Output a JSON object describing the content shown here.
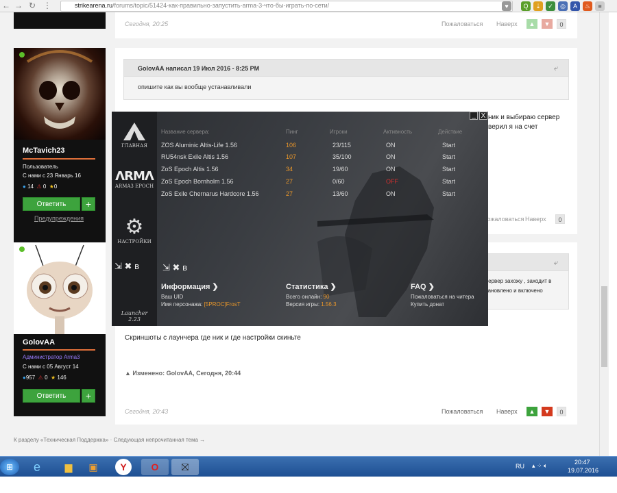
{
  "browser": {
    "url_host": "strikearena.ru",
    "url_path": "/forums/topic/51424-как-правильно-запустить-arma-3-что-бы-играть-по-сети/"
  },
  "top_post": {
    "date": "Сегодня, 20:25",
    "report": "Пожаловаться",
    "up": "Наверх",
    "count": "0"
  },
  "user1": {
    "name": "McTavich23",
    "role": "Пользователь",
    "joined": "С нами с 23 Январь 16",
    "posts": "14",
    "warns": "0",
    "rep": "0",
    "reply": "Ответить",
    "plus": "+",
    "warnings_link": "Предупреждения"
  },
  "post1": {
    "quote_head": "GolovAA написал 19 Июл 2016 - 8:25 PM",
    "quote_text": "опишите как вы вообще устанавливали",
    "text_line1": "ник и выбираю сервер",
    "text_line2": "верил я на счет",
    "report": "Пожаловаться",
    "up": "Наверх",
    "count": "0"
  },
  "user2": {
    "name": "GolovAA",
    "role": "Администратор Arma3",
    "joined": "С нами с 05 Август 14",
    "posts": "957",
    "warns": "0",
    "rep": "146",
    "reply": "Ответить",
    "plus": "+"
  },
  "post2": {
    "text_line1": "вервер захожу , заходит в",
    "text_line2": "тановлено  и включено",
    "main_text": "Скриншоты с лаунчера где ник и где настройки скиньте",
    "edited": "Изменено: GolovAA, Сегодня, 20:44",
    "date": "Сегодня, 20:43",
    "report": "Пожаловаться",
    "up": "Наверх",
    "count": "0"
  },
  "footer": {
    "links": "К разделу «Техническая Поддержка» · Следующая непрочитанная тема →"
  },
  "launcher": {
    "nav": [
      "ГЛАВНАЯ",
      "ARMA3 EPOCH",
      "НАСТРОЙКИ"
    ],
    "version_label": "Launcher",
    "version": "2.23",
    "headers": {
      "name": "Название сервера:",
      "ping": "Пинг",
      "players": "Игроки",
      "activity": "Активность",
      "action": "Действие"
    },
    "servers": [
      {
        "name": "ZOS Aluminic Altis-Life 1.56",
        "ping": "106",
        "players": "23/115",
        "status": "ON",
        "action": "Start"
      },
      {
        "name": "RU54nsk Exile Altis 1.56",
        "ping": "107",
        "players": "35/100",
        "status": "ON",
        "action": "Start"
      },
      {
        "name": "ZoS Epoch Altis 1.56",
        "ping": "34",
        "players": "19/60",
        "status": "ON",
        "action": "Start"
      },
      {
        "name": "ZoS Epoch Bornholm 1.56",
        "ping": "27",
        "players": "0/60",
        "status": "OFF",
        "action": "Start"
      },
      {
        "name": "ZoS Exile Chernarus Hardcore 1.56",
        "ping": "27",
        "players": "13/60",
        "status": "ON",
        "action": "Start"
      }
    ],
    "info": {
      "title": "Информация ❯",
      "uid": "Ваш UID",
      "nick_label": "Имя персонажа: ",
      "nick": "[5PROC]FrosT"
    },
    "stats": {
      "title": "Статистика ❯",
      "online_label": "Всего онлайн: ",
      "online": "90",
      "version_label": "Версия игры: ",
      "version": "1.56.3"
    },
    "faq": {
      "title": "FAQ ❯",
      "report": "Пожаловаться на читера",
      "donate": "Купить донат"
    },
    "win_min": "_",
    "win_close": "X"
  },
  "taskbar": {
    "lang": "RU",
    "time": "20:47",
    "date": "19.07.2016"
  }
}
